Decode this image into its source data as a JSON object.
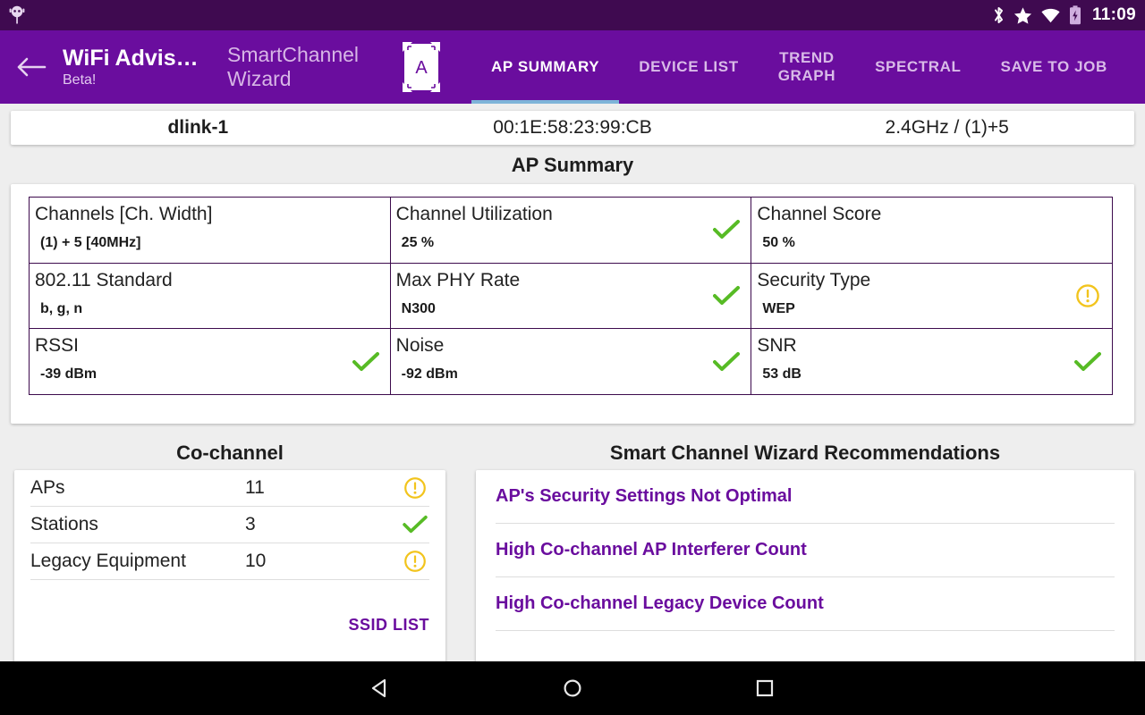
{
  "status_bar": {
    "notification_icon": "android-robot-icon",
    "icons": [
      "bluetooth-icon",
      "star-icon",
      "wifi-icon",
      "battery-charging-icon"
    ],
    "time": "11:09",
    "background_color": "#3f0a50"
  },
  "toolbar": {
    "background_color": "#6a0d9e",
    "back_icon": "back-arrow-icon",
    "app_title": "WiFi Advis…",
    "app_subtitle": "Beta!",
    "module_name": "SmartChannel Wizard",
    "logo_letter": "A",
    "tabs": [
      {
        "label": "AP SUMMARY",
        "active": true
      },
      {
        "label": "DEVICE LIST",
        "active": false
      },
      {
        "label": "TREND\nGRAPH",
        "active": false
      },
      {
        "label": "SPECTRAL",
        "active": false
      },
      {
        "label": "SAVE TO JOB",
        "active": false
      }
    ],
    "active_tab_indicator_color": "#7eb4d8"
  },
  "ap_header": {
    "ssid": "dlink-1",
    "bssid": "00:1E:58:23:99:CB",
    "band_channel": "2.4GHz / (1)+5"
  },
  "ap_summary": {
    "title": "AP Summary",
    "cells": [
      {
        "label": "Channels [Ch. Width]",
        "value": "(1) + 5 [40MHz]",
        "status": "none"
      },
      {
        "label": "Channel Utilization",
        "value": "25 %",
        "status": "ok"
      },
      {
        "label": "Channel Score",
        "value": "50 %",
        "status": "none"
      },
      {
        "label": "802.11 Standard",
        "value": "b, g, n",
        "status": "none"
      },
      {
        "label": "Max PHY Rate",
        "value": "N300",
        "status": "ok"
      },
      {
        "label": "Security Type",
        "value": "WEP",
        "status": "warn"
      },
      {
        "label": "RSSI",
        "value": "-39 dBm",
        "status": "ok"
      },
      {
        "label": "Noise",
        "value": "-92 dBm",
        "status": "ok"
      },
      {
        "label": "SNR",
        "value": "53 dB",
        "status": "ok"
      }
    ]
  },
  "co_channel": {
    "title": "Co-channel",
    "rows": [
      {
        "name": "APs",
        "value": "11",
        "status": "warn"
      },
      {
        "name": "Stations",
        "value": "3",
        "status": "ok"
      },
      {
        "name": "Legacy Equipment",
        "value": "10",
        "status": "warn"
      }
    ],
    "ssid_list_label": "SSID LIST"
  },
  "recommendations": {
    "title": "Smart Channel Wizard Recommendations",
    "items": [
      "AP's Security Settings Not Optimal",
      "High Co-channel AP Interferer Count",
      "High Co-channel Legacy Device Count"
    ]
  },
  "nav_bar": {
    "back_icon": "nav-back-triangle-icon",
    "home_icon": "nav-home-circle-icon",
    "recent_icon": "nav-recent-square-icon"
  },
  "colors": {
    "ok_green": "#57bb25",
    "warn_yellow": "#f2c41d",
    "accent_purple": "#6a0d9e",
    "table_border": "#3d0b4d",
    "page_background": "#eeeeee"
  }
}
